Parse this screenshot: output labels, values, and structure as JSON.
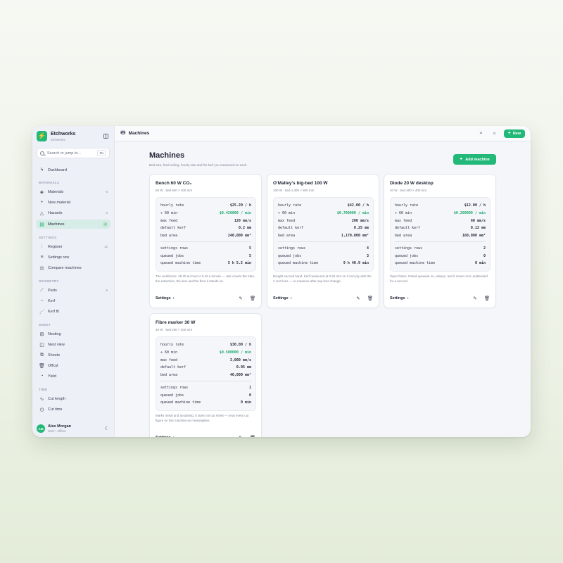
{
  "app": {
    "name": "Etchworks",
    "workspace": "Etchworks"
  },
  "search": {
    "placeholder": "Search or jump to...",
    "shortcut": "⌘K"
  },
  "sidebar": {
    "dashboard": "Dashboard",
    "sections": {
      "materials": "MATERIALS",
      "settings": "SETTINGS",
      "geometry": "GEOMETRY",
      "sheet": "SHEET",
      "time": "TIME"
    },
    "items": {
      "materials": {
        "label": "Materials",
        "count": "6"
      },
      "new_material": {
        "label": "New material"
      },
      "hazards": {
        "label": "Hazards",
        "count": "2"
      },
      "machines": {
        "label": "Machines",
        "count": "4"
      },
      "register": {
        "label": "Register",
        "count": "12"
      },
      "settings_row": {
        "label": "Settings row"
      },
      "compare_machines": {
        "label": "Compare machines"
      },
      "parts": {
        "label": "Parts",
        "count": "6"
      },
      "kerf": {
        "label": "Kerf"
      },
      "kerf_fit": {
        "label": "Kerf fit"
      },
      "nesting": {
        "label": "Nesting"
      },
      "nest_view": {
        "label": "Nest view"
      },
      "sheets": {
        "label": "Sheets"
      },
      "offcut": {
        "label": "Offcut"
      },
      "yield": {
        "label": "Yield"
      },
      "cut_length": {
        "label": "Cut length"
      },
      "cut_time": {
        "label": "Cut time"
      }
    }
  },
  "user": {
    "initials": "AM",
    "name": "Alex Morgan",
    "sub": "USD • offline"
  },
  "topbar": {
    "title": "Machines",
    "new_label": "New"
  },
  "page": {
    "title": "Machines",
    "subtitle": "Bed size, feed ceiling, hourly rate and the kerf you measured on each.",
    "add_label": "Add machine"
  },
  "stat_labels": {
    "hourly_rate": "hourly rate",
    "per_min": "÷ 60 min",
    "max_feed": "max feed",
    "default_kerf": "default kerf",
    "bed_area": "bed area",
    "settings_rows": "settings rows",
    "queued_jobs": "queued jobs",
    "queued_time": "queued machine time"
  },
  "card_actions": {
    "settings": "Settings"
  },
  "machines": [
    {
      "name": "Bench 60 W CO₂",
      "spec": "60 W · bed 600 × 400 mm",
      "hourly_rate": "$25.20 / h",
      "per_min": "$0.420000 / min",
      "max_feed": "120 mm/s",
      "default_kerf": "0.2 mm",
      "bed_area": "240,000 mm²",
      "settings_rows": "5",
      "queued_jobs": "5",
      "queued_time": "5 h 5.2 min",
      "note": "The workhorse. 25.20 an hour is 0.42 a minute — rate covers the tube, the extraction, the lens and the floor it stands on."
    },
    {
      "name": "O'Malley's big-bed 100 W",
      "spec": "100 W · bed 1,300 × 900 mm",
      "hourly_rate": "$42.00 / h",
      "per_min": "$0.700000 / min",
      "max_feed": "200 mm/s",
      "default_kerf": "0.25 mm",
      "bed_area": "1,170,000 mm²",
      "settings_rows": "4",
      "queued_jobs": "3",
      "queued_time": "9 h 40.9 min",
      "note": "Bought second hand. Kerf measured at 0.25 mm on 3 mm ply with the 2 inch lens — re-measure after any lens change."
    },
    {
      "name": "Diode 20 W desktop",
      "spec": "20 W · bed 400 × 400 mm",
      "hourly_rate": "$12.00 / h",
      "per_min": "$0.200000 / min",
      "max_feed": "60 mm/s",
      "default_kerf": "0.12 mm",
      "bed_area": "160,000 mm²",
      "settings_rows": "2",
      "queued_jobs": "0",
      "queued_time": "0 min",
      "note": "Open frame. Rated eyewear on, always, and it never runs unattended for a second."
    },
    {
      "name": "Fibre marker 30 W",
      "spec": "30 W · bed 200 × 200 mm",
      "hourly_rate": "$30.00 / h",
      "per_min": "$0.500000 / min",
      "max_feed": "3,000 mm/s",
      "default_kerf": "0.05 mm",
      "bed_area": "40,000 mm²",
      "settings_rows": "1",
      "queued_jobs": "0",
      "queued_time": "0 min",
      "note": "Marks metal and anodising. It does not cut sheet — treat every cut figure on this machine as meaningless."
    }
  ],
  "colors": {
    "accent": "#22b877",
    "accent_text": "#1aa86b",
    "sidebar_active": "#d6ece6"
  }
}
